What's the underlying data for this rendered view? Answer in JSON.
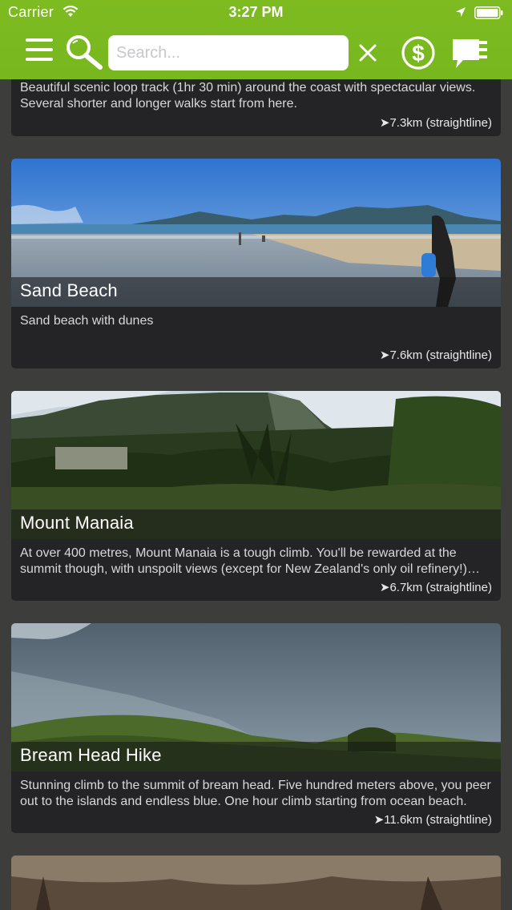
{
  "status_bar": {
    "carrier": "Carrier",
    "time": "3:27 PM"
  },
  "toolbar": {
    "search_placeholder": "Search...",
    "icons": [
      "menu-icon",
      "search-icon",
      "clear-icon",
      "dollar-icon",
      "chat-icon"
    ]
  },
  "colors": {
    "header_green": "#7dbb21",
    "background": "#3d3d3b",
    "card_background": "#242426"
  },
  "cards": [
    {
      "title": "",
      "description": "Beautiful scenic loop track (1hr 30 min) around the coast with spectacular views. Several shorter and longer walks start from here.",
      "distance": "➤7.3km (straightline)"
    },
    {
      "title": "Sand Beach",
      "description": "Sand beach with dunes",
      "distance": "➤7.6km (straightline)"
    },
    {
      "title": "Mount Manaia",
      "description": "At over 400 metres, Mount Manaia is a tough climb. You'll be rewarded at the summit though, with unspoilt views (except for New Zealand's only oil refinery!) from the top.",
      "distance": "➤6.7km (straightline)"
    },
    {
      "title": "Bream Head Hike",
      "description": "Stunning climb to the summit of bream head. Five hundred meters above, you peer out to the islands and endless blue. One hour climb starting from ocean beach.",
      "distance": "➤11.6km (straightline)"
    }
  ]
}
